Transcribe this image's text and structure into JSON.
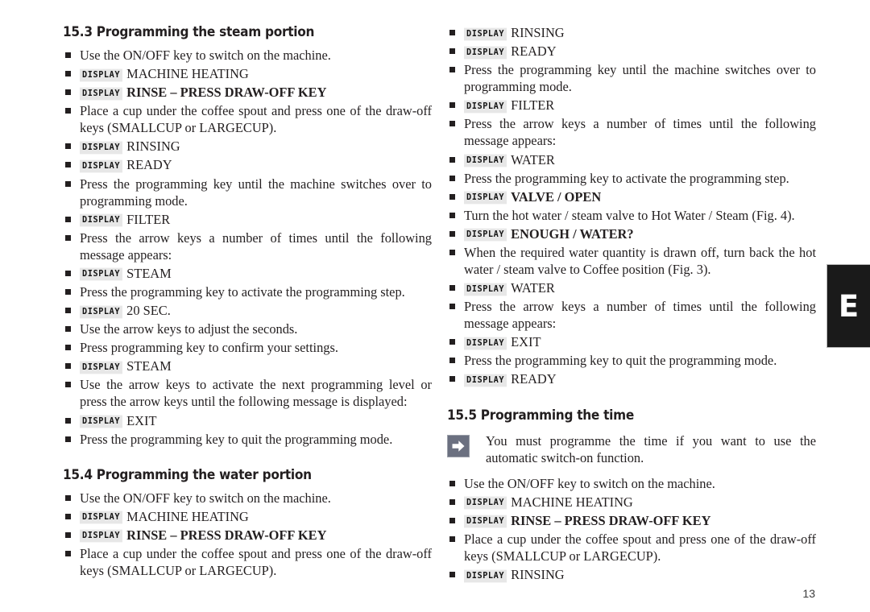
{
  "page": {
    "number": "13",
    "edge_tab_letter": "E"
  },
  "badges": {
    "display_label": "DISPLAY"
  },
  "icons": {
    "arrow_right": "arrow-right-icon",
    "bullet": "square-bullet-icon"
  },
  "colors": {
    "text": "#231f20",
    "badge_bg": "#e7e7e7",
    "note_icon_bg": "#6b7080",
    "tab_bg": "#1a1a1a"
  },
  "sections": [
    {
      "id": "15-3",
      "heading": "15.3 Programming the steam portion",
      "column": "left",
      "items": [
        {
          "type": "text",
          "text": "Use the ON/OFF key to switch on the machine.",
          "justify": false
        },
        {
          "type": "display",
          "text": "MACHINE HEATING",
          "bold": false
        },
        {
          "type": "display",
          "text": "RINSE – PRESS DRAW-OFF KEY",
          "bold": true
        },
        {
          "type": "text",
          "text": "Place a cup under the coffee spout and press one of the draw-off keys (SMALLCUP or LARGECUP).",
          "justify": true
        },
        {
          "type": "display",
          "text": "RINSING",
          "bold": false
        },
        {
          "type": "display",
          "text": "READY",
          "bold": false
        },
        {
          "type": "text",
          "text": "Press the programming key until the machine switches over to programming mode.",
          "justify": true
        },
        {
          "type": "display",
          "text": "FILTER",
          "bold": false
        },
        {
          "type": "text",
          "text": "Press the arrow keys a number of times until the following message appears:",
          "justify": true
        },
        {
          "type": "display",
          "text": "STEAM",
          "bold": false
        },
        {
          "type": "text",
          "text": "Press the programming key to activate the programming step.",
          "justify": false
        },
        {
          "type": "display",
          "text": "20 SEC.",
          "bold": false
        },
        {
          "type": "text",
          "text": "Use the arrow keys to adjust the seconds.",
          "justify": false
        },
        {
          "type": "text",
          "text": "Press programming key to confirm your settings.",
          "justify": false
        },
        {
          "type": "display",
          "text": "STEAM",
          "bold": false
        },
        {
          "type": "text",
          "text": "Use the arrow keys to activate the next programming level or press the arrow keys until the following message is displayed:",
          "justify": true
        },
        {
          "type": "display",
          "text": "EXIT",
          "bold": false
        },
        {
          "type": "text",
          "text": "Press the programming key to quit the programming mode.",
          "justify": false
        }
      ]
    },
    {
      "id": "15-4",
      "heading": "15.4 Programming the water portion",
      "column": "left",
      "items": [
        {
          "type": "text",
          "text": "Use the ON/OFF key to switch on the machine.",
          "justify": false
        },
        {
          "type": "display",
          "text": "MACHINE HEATING",
          "bold": false
        },
        {
          "type": "display",
          "text": "RINSE – PRESS DRAW-OFF KEY",
          "bold": true
        },
        {
          "type": "text",
          "text": "Place a cup under the coffee spout and press one of the draw-off keys (SMALLCUP or LARGECUP).",
          "justify": true
        }
      ]
    },
    {
      "id": "15-4-cont",
      "heading": "",
      "column": "right",
      "items": [
        {
          "type": "display",
          "text": "RINSING",
          "bold": false
        },
        {
          "type": "display",
          "text": "READY",
          "bold": false
        },
        {
          "type": "text",
          "text": "Press the programming key until the machine switches over to programming mode.",
          "justify": true
        },
        {
          "type": "display",
          "text": "FILTER",
          "bold": false
        },
        {
          "type": "text",
          "text": "Press the arrow keys a number of times until the following message appears:",
          "justify": true
        },
        {
          "type": "display",
          "text": "WATER",
          "bold": false
        },
        {
          "type": "text",
          "text": "Press the programming key to activate the programming step.",
          "justify": false
        },
        {
          "type": "display",
          "text": "VALVE / OPEN",
          "bold": true
        },
        {
          "type": "text",
          "text": "Turn the hot water / steam valve to Hot Water / Steam (Fig. 4).",
          "justify": false
        },
        {
          "type": "display",
          "text": "ENOUGH / WATER?",
          "bold": true
        },
        {
          "type": "text",
          "text": "When the required water quantity is drawn off, turn back the hot water / steam valve to Coffee position (Fig. 3).",
          "justify": true
        },
        {
          "type": "display",
          "text": "WATER",
          "bold": false
        },
        {
          "type": "text",
          "text": "Press the arrow keys a number of times until the following message appears:",
          "justify": true
        },
        {
          "type": "display",
          "text": "EXIT",
          "bold": false
        },
        {
          "type": "text",
          "text": "Press the programming key to quit the programming mode.",
          "justify": false
        },
        {
          "type": "display",
          "text": "READY",
          "bold": false
        }
      ]
    },
    {
      "id": "15-5",
      "heading": "15.5 Programming the time",
      "column": "right",
      "note": "You must programme the time if you want to use the automatic switch-on function.",
      "items": [
        {
          "type": "text",
          "text": "Use the ON/OFF key to switch on the machine.",
          "justify": false
        },
        {
          "type": "display",
          "text": "MACHINE HEATING",
          "bold": false
        },
        {
          "type": "display",
          "text": "RINSE – PRESS DRAW-OFF KEY",
          "bold": true
        },
        {
          "type": "text",
          "text": "Place a cup under the coffee spout and press one of the draw-off keys (SMALLCUP or LARGECUP).",
          "justify": true
        },
        {
          "type": "display",
          "text": "RINSING",
          "bold": false
        }
      ]
    }
  ]
}
